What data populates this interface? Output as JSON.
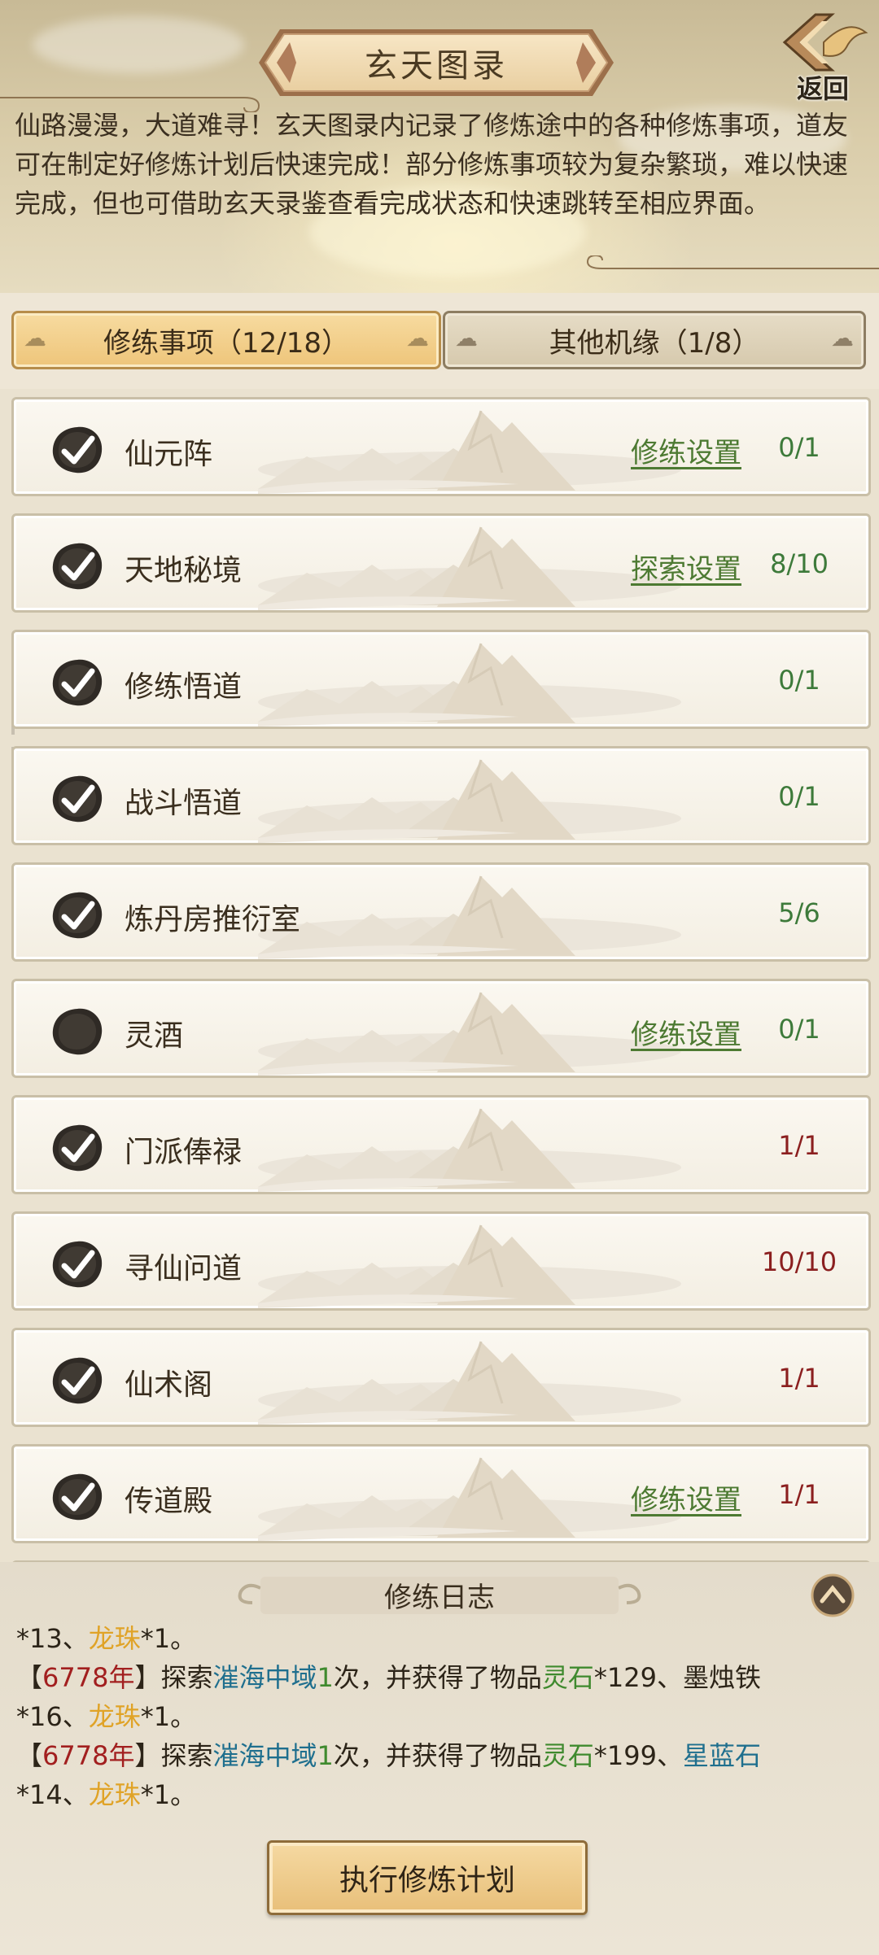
{
  "header": {
    "title": "玄天图录",
    "back_label": "返回",
    "intro": "仙路漫漫，大道难寻！玄天图录内记录了修炼途中的各种修炼事项，道友可在制定好修炼计划后快速完成！部分修炼事项较为复杂繁琐，难以快速完成，但也可借助玄天录鉴查看完成状态和快速跳转至相应界面。"
  },
  "tabs": [
    {
      "label": "修练事项（12/18）",
      "active": true
    },
    {
      "label": "其他机缘（1/8）",
      "active": false
    }
  ],
  "items": [
    {
      "name": "仙元阵",
      "action": "修练设置",
      "count": "0/1",
      "checked": true,
      "complete": false
    },
    {
      "name": "天地秘境",
      "action": "探索设置",
      "count": "8/10",
      "checked": true,
      "complete": false
    },
    {
      "name": "修练悟道",
      "action": "",
      "count": "0/1",
      "checked": true,
      "complete": false
    },
    {
      "name": "战斗悟道",
      "action": "",
      "count": "0/1",
      "checked": true,
      "complete": false
    },
    {
      "name": "炼丹房推衍室",
      "action": "",
      "count": "5/6",
      "checked": true,
      "complete": false
    },
    {
      "name": "灵酒",
      "action": "修练设置",
      "count": "0/1",
      "checked": false,
      "complete": false
    },
    {
      "name": "门派俸禄",
      "action": "",
      "count": "1/1",
      "checked": true,
      "complete": true
    },
    {
      "name": "寻仙问道",
      "action": "",
      "count": "10/10",
      "checked": true,
      "complete": true
    },
    {
      "name": "仙术阁",
      "action": "",
      "count": "1/1",
      "checked": true,
      "complete": true
    },
    {
      "name": "传道殿",
      "action": "修练设置",
      "count": "1/1",
      "checked": true,
      "complete": true
    }
  ],
  "log": {
    "title": "修练日志",
    "line1": {
      "pre": "*13、",
      "item": "龙珠",
      "post": "*1。"
    },
    "entry1": {
      "lb": "【",
      "year": "6778年",
      "rb": "】探索",
      "place": "漼海中域",
      "times": "1",
      "mid": "次，并获得了物品",
      "item1": "灵石",
      "qty1": "*129、墨烛铁",
      "cont_pre": "*16、",
      "item2": "龙珠",
      "cont_post": "*1。"
    },
    "entry2": {
      "lb": "【",
      "year": "6778年",
      "rb": "】探索",
      "place": "漼海中域",
      "times": "1",
      "mid": "次，并获得了物品",
      "item1": "灵石",
      "qty1": "*199、",
      "item3": "星蓝石",
      "cont_pre": "*14、",
      "item2": "龙珠",
      "cont_post": "*1。"
    }
  },
  "execute_label": "执行修炼计划",
  "colors": {
    "accent_gold": "#e0a327",
    "place_blue": "#1f6f8e",
    "item_green": "#3f8a2e",
    "year_red": "#a21f1f",
    "action_green": "#4d7a32",
    "complete_red": "#8b1f1f"
  }
}
